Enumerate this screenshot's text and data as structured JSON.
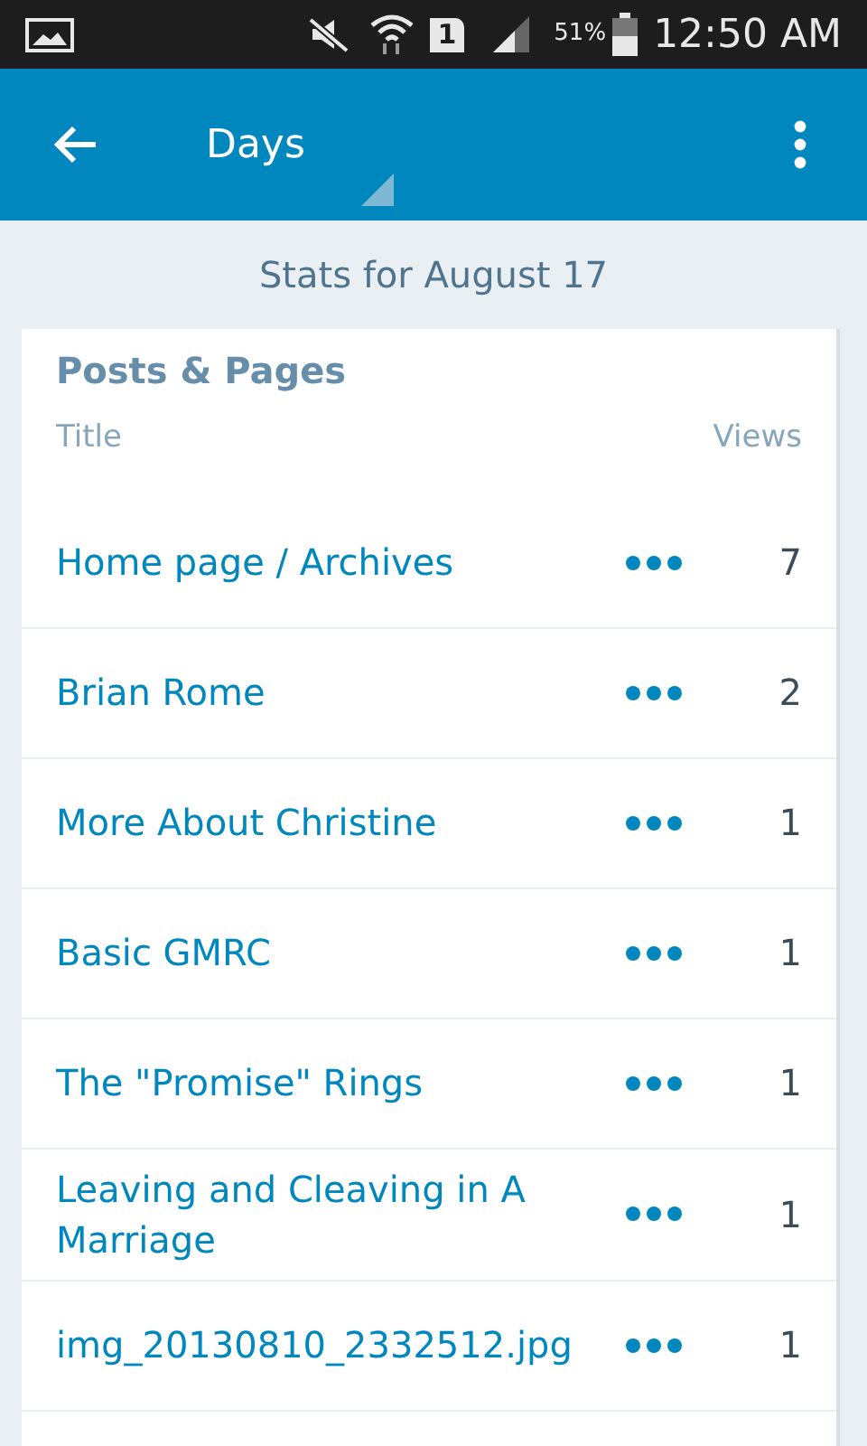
{
  "status_bar": {
    "sim_slot": "1",
    "battery": "51%",
    "time": "12:50 AM"
  },
  "app_bar": {
    "title": "Days"
  },
  "subtitle": "Stats for August 17",
  "card": {
    "title": "Posts & Pages",
    "columns": [
      "Title",
      "Views"
    ],
    "rows": [
      {
        "title": "Home page / Archives",
        "views": "7"
      },
      {
        "title": "Brian Rome",
        "views": "2"
      },
      {
        "title": "More About Christine",
        "views": "1"
      },
      {
        "title": "Basic GMRC",
        "views": "1"
      },
      {
        "title": "The \"Promise\" Rings",
        "views": "1"
      },
      {
        "title": "Leaving and Cleaving in A Marriage",
        "views": "1"
      },
      {
        "title": "img_20130810_2332512.jpg",
        "views": "1"
      }
    ]
  }
}
